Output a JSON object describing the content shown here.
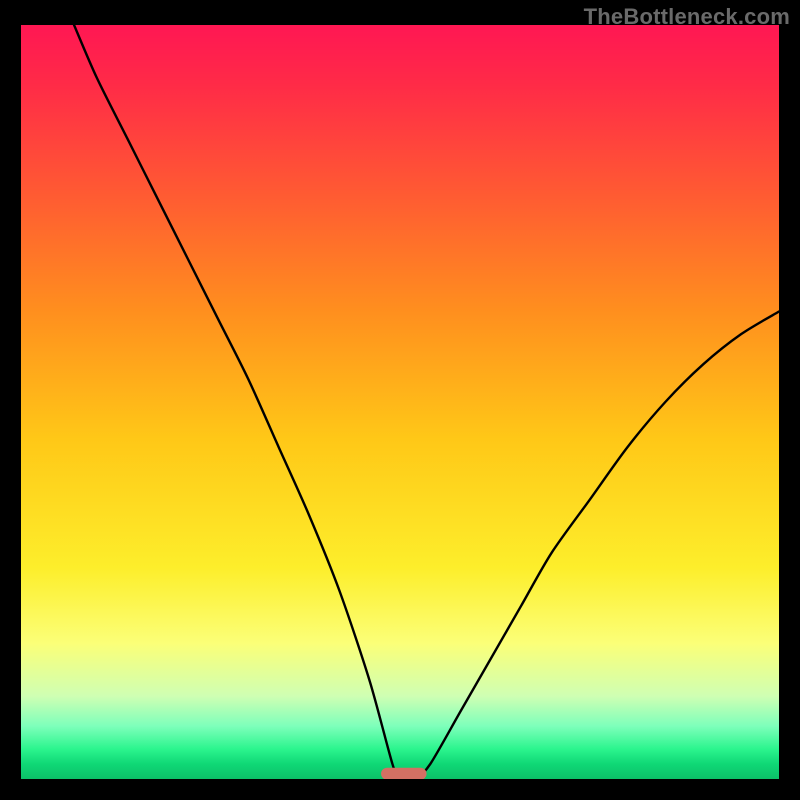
{
  "watermark": "TheBottleneck.com",
  "colors": {
    "frame_border": "#000000",
    "curve_stroke": "#000000",
    "marker_fill": "#d37063",
    "gradient_top": "#ff1753",
    "gradient_bottom": "#0cc068"
  },
  "chart_data": {
    "type": "line",
    "title": "",
    "xlabel": "",
    "ylabel": "",
    "xlim": [
      0,
      100
    ],
    "ylim": [
      0,
      100
    ],
    "axis_ticks_visible": false,
    "gridlines": false,
    "legend": false,
    "notes": "Single V-shaped curve on vertical red→green gradient. Minimum near x≈50 at y≈0. Left arm starts at top-left corner (x≈7, y≈100); right arm exits at right edge near (x≈100, y≈62). A small salmon pill marks the minimum region at the bottom. No numeric axis labels or ticks are shown.",
    "series": [
      {
        "name": "bottleneck-curve",
        "x": [
          7,
          10,
          14,
          18,
          22,
          26,
          30,
          34,
          38,
          42,
          46,
          49,
          50,
          52,
          54,
          58,
          62,
          66,
          70,
          75,
          80,
          85,
          90,
          95,
          100
        ],
        "y": [
          100,
          93,
          85,
          77,
          69,
          61,
          53,
          44,
          35,
          25,
          13,
          2,
          0,
          0,
          2,
          9,
          16,
          23,
          30,
          37,
          44,
          50,
          55,
          59,
          62
        ]
      }
    ],
    "marker": {
      "x_center": 50.5,
      "y": 0.7,
      "width": 6,
      "height": 1.6
    }
  }
}
